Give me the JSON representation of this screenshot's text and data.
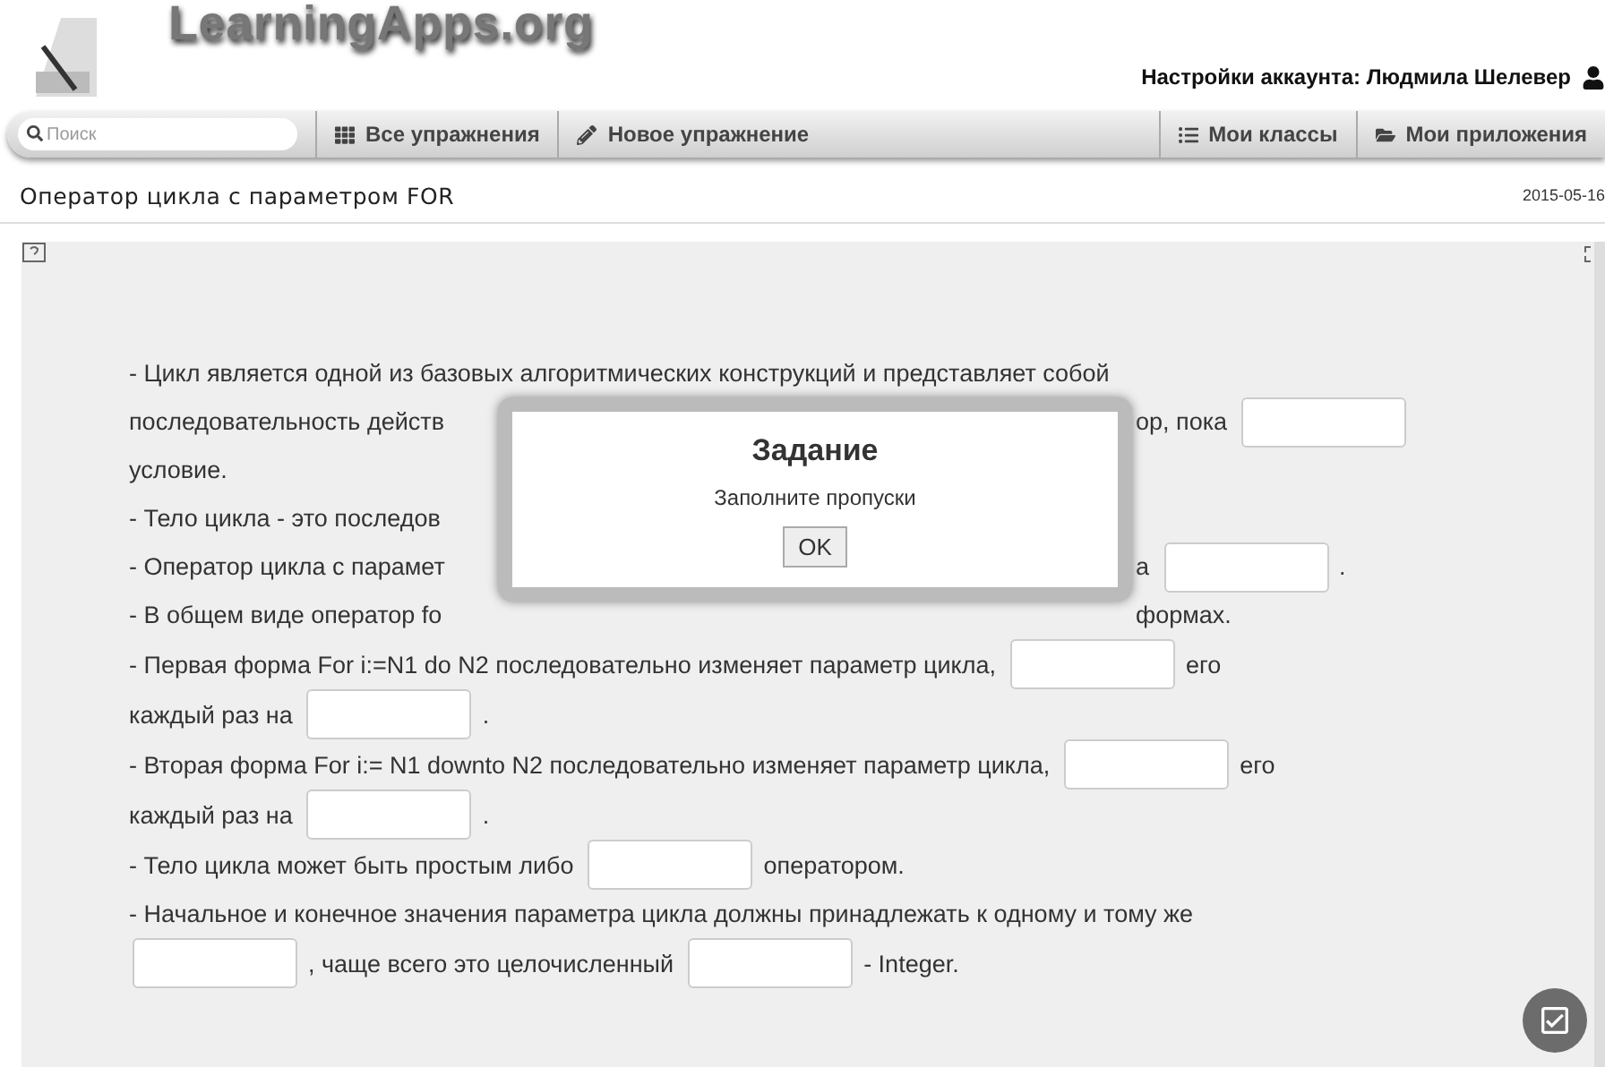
{
  "logo": "LearningApps.org",
  "account": {
    "label": "Настройки аккаунта: Людмила Шелевер"
  },
  "search": {
    "placeholder": "Поиск"
  },
  "nav": [
    {
      "label": "Все упражнения"
    },
    {
      "label": "Новое упражнение"
    },
    {
      "label": "Мои классы"
    },
    {
      "label": "Мои приложения"
    }
  ],
  "title": "Оператор цикла с параметром FOR",
  "date": "2015-05-16",
  "lines": [
    {
      "left": [
        {
          "kind": "text",
          "text": "- Цикл является одной из базовых алгоритмических конструкций и представляет собой"
        }
      ]
    },
    {
      "left": [
        {
          "kind": "text",
          "text": "последовательность действ"
        }
      ],
      "right": [
        {
          "kind": "text",
          "text": "ор, пока"
        },
        {
          "kind": "blank"
        }
      ]
    },
    {
      "left": [
        {
          "kind": "text",
          "text": "условие."
        }
      ]
    },
    {
      "left": [
        {
          "kind": "text",
          "text": "- Тело цикла - это последов"
        }
      ]
    },
    {
      "left": [
        {
          "kind": "text",
          "text": "- Оператор цикла с парамет"
        }
      ],
      "right": [
        {
          "kind": "text",
          "text": "а"
        },
        {
          "kind": "blank"
        },
        {
          "kind": "text",
          "text": "."
        }
      ]
    },
    {
      "left": [
        {
          "kind": "text",
          "text": "- В общем виде оператор fo"
        }
      ],
      "right": [
        {
          "kind": "text",
          "text": "формах."
        }
      ]
    },
    {
      "left": [
        {
          "kind": "text",
          "text": "- Первая форма For i:=N1 do N2 последовательно изменяет параметр цикла,"
        },
        {
          "kind": "blank"
        },
        {
          "kind": "text",
          "text": "его"
        }
      ]
    },
    {
      "left": [
        {
          "kind": "text",
          "text": "каждый раз на"
        },
        {
          "kind": "blank"
        },
        {
          "kind": "text",
          "text": "."
        }
      ]
    },
    {
      "left": [
        {
          "kind": "text",
          "text": "- Вторая форма For i:= N1 downto N2 последовательно изменяет параметр цикла,"
        },
        {
          "kind": "blank"
        },
        {
          "kind": "text",
          "text": "его"
        }
      ]
    },
    {
      "left": [
        {
          "kind": "text",
          "text": "каждый раз на"
        },
        {
          "kind": "blank"
        },
        {
          "kind": "text",
          "text": "."
        }
      ]
    },
    {
      "left": [
        {
          "kind": "text",
          "text": "- Тело цикла может быть простым либо"
        },
        {
          "kind": "blank"
        },
        {
          "kind": "text",
          "text": "оператором."
        }
      ]
    },
    {
      "left": [
        {
          "kind": "text",
          "text": "- Начальное и конечное значения параметра цикла должны принадлежать к одному и тому же"
        }
      ]
    },
    {
      "left": [
        {
          "kind": "blank"
        },
        {
          "kind": "text",
          "text": ", чаще всего это целочисленный"
        },
        {
          "kind": "blank"
        },
        {
          "kind": "text",
          "text": "- Integer."
        }
      ]
    }
  ],
  "dialog": {
    "title": "Задание",
    "message": "Заполните пропуски",
    "button": "OK"
  }
}
